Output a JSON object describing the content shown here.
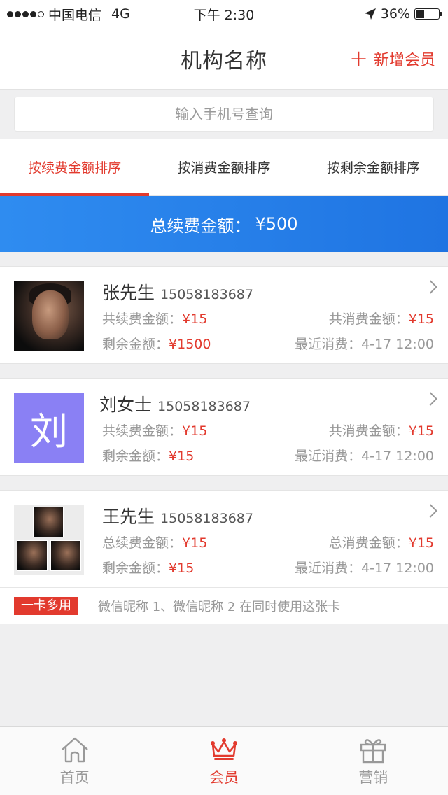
{
  "status_bar": {
    "carrier": "中国电信",
    "network": "4G",
    "time": "下午 2:30",
    "battery": "36%",
    "battery_level": 0.36
  },
  "header": {
    "title": "机构名称",
    "add_label": "新增会员"
  },
  "search": {
    "placeholder": "输入手机号查询"
  },
  "sort_tabs": [
    {
      "label": "按续费金额排序",
      "active": true
    },
    {
      "label": "按消费金额排序",
      "active": false
    },
    {
      "label": "按剩余金额排序",
      "active": false
    }
  ],
  "total": {
    "label": "总续费金额：",
    "value": "¥500"
  },
  "members": [
    {
      "name": "张先生",
      "phone": "15058183687",
      "renew_label": "共续费金额：",
      "renew_value": "¥15",
      "spend_label": "共消费金额：",
      "spend_value": "¥15",
      "remain_label": "剩余金额：",
      "remain_value": "¥1500",
      "recent_label": "最近消费：",
      "recent_value": "4-17 12:00"
    },
    {
      "name": "刘女士",
      "phone": "15058183687",
      "avatar_letter": "刘",
      "renew_label": "共续费金额：",
      "renew_value": "¥15",
      "spend_label": "共消费金额：",
      "spend_value": "¥15",
      "remain_label": "剩余金额：",
      "remain_value": "¥15",
      "recent_label": "最近消费：",
      "recent_value": "4-17 12:00"
    },
    {
      "name": "王先生",
      "phone": "15058183687",
      "renew_label": "总续费金额：",
      "renew_value": "¥15",
      "spend_label": "总消费金额：",
      "spend_value": "¥15",
      "remain_label": "剩余金额：",
      "remain_value": "¥15",
      "recent_label": "最近消费：",
      "recent_value": "4-17 12:00",
      "badge": "一卡多用",
      "shared_note": "微信昵称 1、微信昵称 2 在同时使用这张卡"
    }
  ],
  "tabbar": [
    {
      "label": "首页",
      "icon": "home-icon",
      "active": false
    },
    {
      "label": "会员",
      "icon": "crown-icon",
      "active": true
    },
    {
      "label": "营销",
      "icon": "gift-icon",
      "active": false
    }
  ],
  "colors": {
    "accent": "#e23a2e",
    "banner": "#2f8cf0",
    "letter_avatar": "#8a80f4"
  }
}
